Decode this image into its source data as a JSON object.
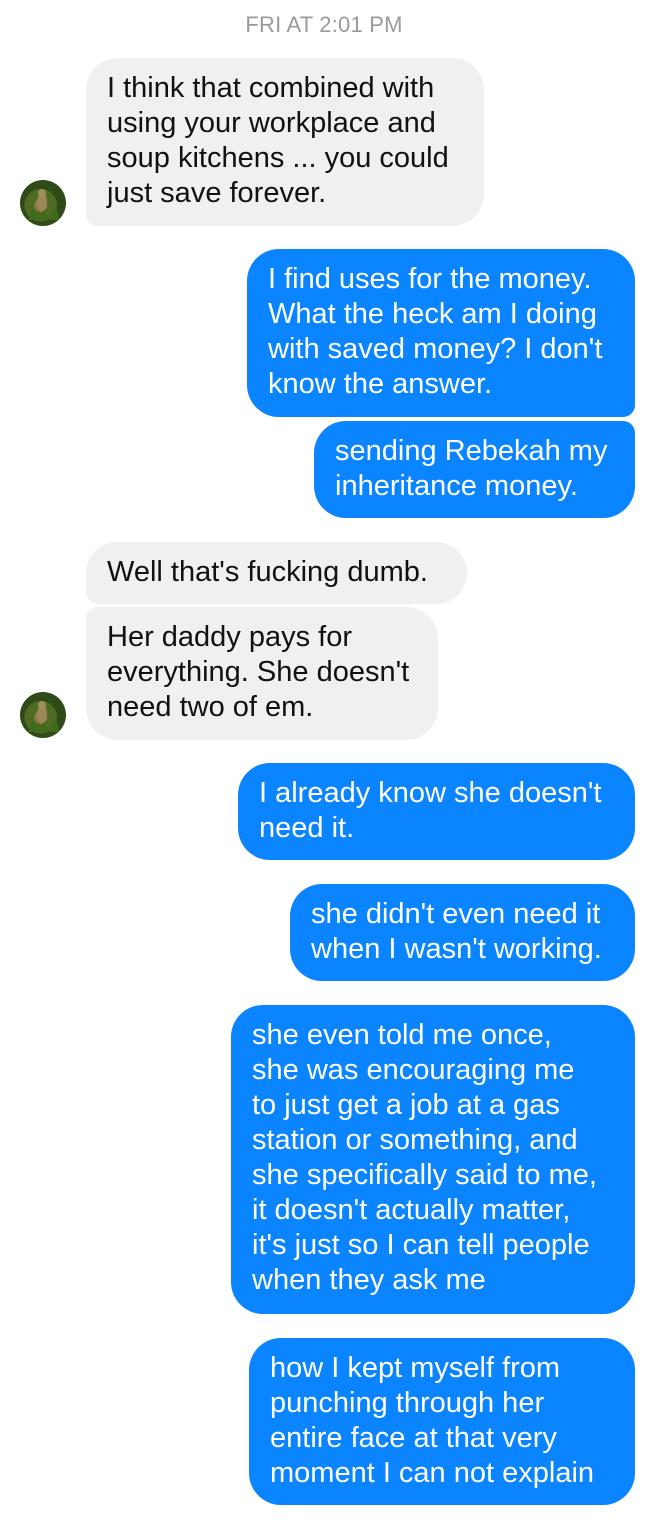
{
  "thread": {
    "timestamp": "FRI AT 2:01 PM",
    "messages": [
      {
        "from": "them",
        "text": "I think that combined with\nusing your workplace and\nsoup kitchens ... you could\njust save forever."
      },
      {
        "from": "me",
        "text": "I find uses for the money.\nWhat the heck am I doing\nwith saved money? I don't\nknow the answer."
      },
      {
        "from": "me",
        "text": "sending Rebekah my\ninheritance money."
      },
      {
        "from": "them",
        "text": "Well that's fucking dumb."
      },
      {
        "from": "them",
        "text": "Her daddy pays for\neverything. She doesn't\nneed two of em."
      },
      {
        "from": "me",
        "text": "I already know she doesn't\nneed it."
      },
      {
        "from": "me",
        "text": "she didn't even need it\nwhen I wasn't working."
      },
      {
        "from": "me",
        "text": "she even told me once,\nshe was encouraging me\nto just get a job at a gas\nstation or something, and\nshe specifically said to me,\nit doesn't actually matter,\nit's just so I can tell people\nwhen they ask me"
      },
      {
        "from": "me",
        "text": "how I kept myself from\npunching through her\nentire face at that very\nmoment I can not explain"
      }
    ]
  },
  "colors": {
    "outgoing": "#0a84ff",
    "incoming": "#f1f0f0",
    "timestamp": "#9a9a9a"
  },
  "icons": [
    "contact-avatar"
  ]
}
